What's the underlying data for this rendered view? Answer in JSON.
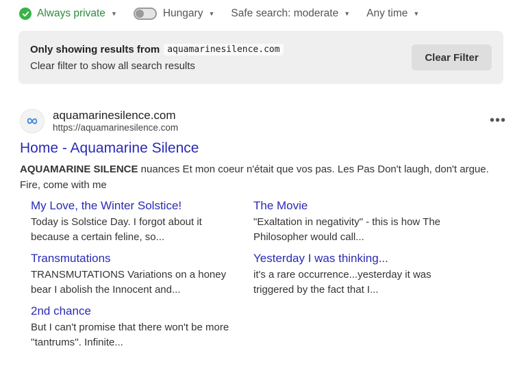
{
  "filters": {
    "private_label": "Always private",
    "region_label": "Hungary",
    "safe_search_label": "Safe search: moderate",
    "time_label": "Any time"
  },
  "site_filter": {
    "prefix": "Only showing results from",
    "domain": "aquamarinesilence.com",
    "hint": "Clear filter to show all search results",
    "clear_button": "Clear Filter"
  },
  "result": {
    "site_name": "aquamarinesilence.com",
    "url": "https://aquamarinesilence.com",
    "title": "Home - Aquamarine Silence",
    "snippet_bold": "AQUAMARINE SILENCE",
    "snippet_rest": " nuances Et mon coeur n'était que vos pas. Les Pas Don't laugh, don't argue. Fire, come with me",
    "more_label": "•••",
    "sitelinks": [
      {
        "title": "My Love, the Winter Solstice!",
        "desc": "Today is Solstice Day. I forgot about it because a certain feline, so..."
      },
      {
        "title": "The Movie",
        "desc": "\"Exaltation in negativity\" - this is how The Philosopher would call..."
      },
      {
        "title": "Transmutations",
        "desc": "TRANSMUTATIONS Variations on a honey bear I abolish the Innocent and..."
      },
      {
        "title": "Yesterday I was thinking...",
        "desc": "it's a rare occurrence...yesterday it was triggered by the fact that I..."
      },
      {
        "title": "2nd chance",
        "desc": "But I can't promise that there won't be more ''tantrums''. Infinite..."
      }
    ]
  },
  "icons": {
    "private": "check-circle-icon",
    "region": "toggle-icon",
    "caret": "caret-down-icon",
    "favicon": "infinity-logo-icon",
    "more": "more-horizontal-icon"
  },
  "colors": {
    "link": "#2a2ab4",
    "private_green": "#3ab34a",
    "filter_box_bg": "#efefef",
    "button_bg": "#dedede"
  }
}
